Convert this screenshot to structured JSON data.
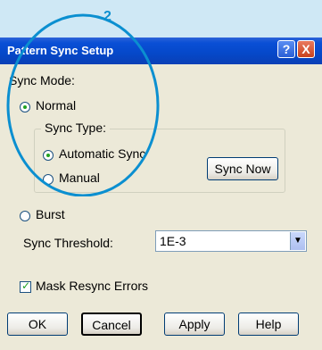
{
  "annotation": {
    "step": "2"
  },
  "window": {
    "title": "Pattern Sync Setup",
    "help_glyph": "?",
    "close_glyph": "X"
  },
  "sync_mode": {
    "label": "Sync Mode:",
    "normal_label": "Normal",
    "normal_selected": true,
    "burst_label": "Burst",
    "burst_selected": false
  },
  "sync_type": {
    "label": "Sync Type:",
    "automatic_label": "Automatic Sync",
    "automatic_selected": true,
    "manual_label": "Manual",
    "manual_selected": false,
    "sync_now_label": "Sync Now"
  },
  "threshold": {
    "label": "Sync Threshold:",
    "value": "1E-3"
  },
  "mask_resync": {
    "label": "Mask Resync Errors",
    "checked": true
  },
  "buttons": {
    "ok": "OK",
    "cancel": "Cancel",
    "apply": "Apply",
    "help": "Help"
  }
}
